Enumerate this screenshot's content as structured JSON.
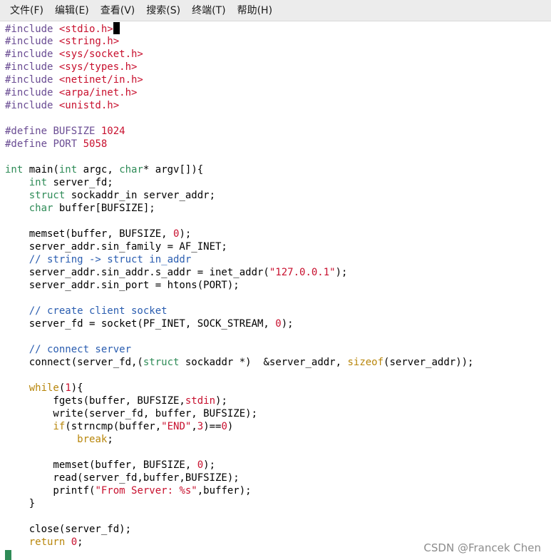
{
  "menu": [
    {
      "label": "文件(F)"
    },
    {
      "label": "编辑(E)"
    },
    {
      "label": "查看(V)"
    },
    {
      "label": "搜索(S)"
    },
    {
      "label": "终端(T)"
    },
    {
      "label": "帮助(H)"
    }
  ],
  "code_lines": [
    [
      {
        "t": "#include ",
        "c": "pp"
      },
      {
        "t": "<stdio.h>",
        "c": "hdr"
      },
      {
        "cursor": true
      }
    ],
    [
      {
        "t": "#include ",
        "c": "pp"
      },
      {
        "t": "<string.h>",
        "c": "hdr"
      }
    ],
    [
      {
        "t": "#include ",
        "c": "pp"
      },
      {
        "t": "<sys/socket.h>",
        "c": "hdr"
      }
    ],
    [
      {
        "t": "#include ",
        "c": "pp"
      },
      {
        "t": "<sys/types.h>",
        "c": "hdr"
      }
    ],
    [
      {
        "t": "#include ",
        "c": "pp"
      },
      {
        "t": "<netinet/in.h>",
        "c": "hdr"
      }
    ],
    [
      {
        "t": "#include ",
        "c": "pp"
      },
      {
        "t": "<arpa/inet.h>",
        "c": "hdr"
      }
    ],
    [
      {
        "t": "#include ",
        "c": "pp"
      },
      {
        "t": "<unistd.h>",
        "c": "hdr"
      }
    ],
    [],
    [
      {
        "t": "#define ",
        "c": "pp"
      },
      {
        "t": "BUFSIZE ",
        "c": "pp"
      },
      {
        "t": "1024",
        "c": "num"
      }
    ],
    [
      {
        "t": "#define ",
        "c": "pp"
      },
      {
        "t": "PORT ",
        "c": "pp"
      },
      {
        "t": "5058",
        "c": "num"
      }
    ],
    [],
    [
      {
        "t": "int",
        "c": "ty"
      },
      {
        "t": " main(",
        "c": "p"
      },
      {
        "t": "int",
        "c": "ty"
      },
      {
        "t": " argc, ",
        "c": "p"
      },
      {
        "t": "char",
        "c": "ty"
      },
      {
        "t": "* argv[]){",
        "c": "p"
      }
    ],
    [
      {
        "t": "    ",
        "c": "p"
      },
      {
        "t": "int",
        "c": "ty"
      },
      {
        "t": " server_fd;",
        "c": "p"
      }
    ],
    [
      {
        "t": "    ",
        "c": "p"
      },
      {
        "t": "struct",
        "c": "kw"
      },
      {
        "t": " sockaddr_in server_addr;",
        "c": "p"
      }
    ],
    [
      {
        "t": "    ",
        "c": "p"
      },
      {
        "t": "char",
        "c": "ty"
      },
      {
        "t": " buffer[BUFSIZE];",
        "c": "p"
      }
    ],
    [],
    [
      {
        "t": "    memset(buffer, BUFSIZE, ",
        "c": "p"
      },
      {
        "t": "0",
        "c": "num"
      },
      {
        "t": ");",
        "c": "p"
      }
    ],
    [
      {
        "t": "    server_addr.sin_family = AF_INET;",
        "c": "p"
      }
    ],
    [
      {
        "t": "    ",
        "c": "p"
      },
      {
        "t": "// string -> struct in_addr",
        "c": "com"
      }
    ],
    [
      {
        "t": "    server_addr.sin_addr.s_addr = inet_addr(",
        "c": "p"
      },
      {
        "t": "\"127.0.0.1\"",
        "c": "str"
      },
      {
        "t": ");",
        "c": "p"
      }
    ],
    [
      {
        "t": "    server_addr.sin_port = htons(PORT);",
        "c": "p"
      }
    ],
    [],
    [
      {
        "t": "    ",
        "c": "p"
      },
      {
        "t": "// create client socket",
        "c": "com"
      }
    ],
    [
      {
        "t": "    server_fd = socket(PF_INET, SOCK_STREAM, ",
        "c": "p"
      },
      {
        "t": "0",
        "c": "num"
      },
      {
        "t": ");",
        "c": "p"
      }
    ],
    [],
    [
      {
        "t": "    ",
        "c": "p"
      },
      {
        "t": "// connect server",
        "c": "com"
      }
    ],
    [
      {
        "t": "    connect(server_fd,(",
        "c": "p"
      },
      {
        "t": "struct",
        "c": "kw"
      },
      {
        "t": " sockaddr *)  &server_addr, ",
        "c": "p"
      },
      {
        "t": "sizeof",
        "c": "fn"
      },
      {
        "t": "(server_addr));",
        "c": "p"
      }
    ],
    [],
    [
      {
        "t": "    ",
        "c": "p"
      },
      {
        "t": "while",
        "c": "fn"
      },
      {
        "t": "(",
        "c": "p"
      },
      {
        "t": "1",
        "c": "num"
      },
      {
        "t": "){",
        "c": "p"
      }
    ],
    [
      {
        "t": "        fgets(buffer, BUFSIZE,",
        "c": "p"
      },
      {
        "t": "stdin",
        "c": "str"
      },
      {
        "t": ");",
        "c": "p"
      }
    ],
    [
      {
        "t": "        write(server_fd, buffer, BUFSIZE);",
        "c": "p"
      }
    ],
    [
      {
        "t": "        ",
        "c": "p"
      },
      {
        "t": "if",
        "c": "fn"
      },
      {
        "t": "(strncmp(buffer,",
        "c": "p"
      },
      {
        "t": "\"END\"",
        "c": "str"
      },
      {
        "t": ",",
        "c": "p"
      },
      {
        "t": "3",
        "c": "num"
      },
      {
        "t": ")==",
        "c": "p"
      },
      {
        "t": "0",
        "c": "num"
      },
      {
        "t": ")",
        "c": "p"
      }
    ],
    [
      {
        "t": "            ",
        "c": "p"
      },
      {
        "t": "break",
        "c": "fn"
      },
      {
        "t": ";",
        "c": "p"
      }
    ],
    [],
    [
      {
        "t": "        memset(buffer, BUFSIZE, ",
        "c": "p"
      },
      {
        "t": "0",
        "c": "num"
      },
      {
        "t": ");",
        "c": "p"
      }
    ],
    [
      {
        "t": "        read(server_fd,buffer,BUFSIZE);",
        "c": "p"
      }
    ],
    [
      {
        "t": "        printf(",
        "c": "p"
      },
      {
        "t": "\"From Server: %s\"",
        "c": "str"
      },
      {
        "t": ",buffer);",
        "c": "p"
      }
    ],
    [
      {
        "t": "    }",
        "c": "p"
      }
    ],
    [],
    [
      {
        "t": "    close(server_fd);",
        "c": "p"
      }
    ],
    [
      {
        "t": "    ",
        "c": "p"
      },
      {
        "t": "return",
        "c": "fn"
      },
      {
        "t": " ",
        "c": "p"
      },
      {
        "t": "0",
        "c": "num"
      },
      {
        "t": ";",
        "c": "p"
      }
    ]
  ],
  "watermark": "CSDN @Francek Chen"
}
